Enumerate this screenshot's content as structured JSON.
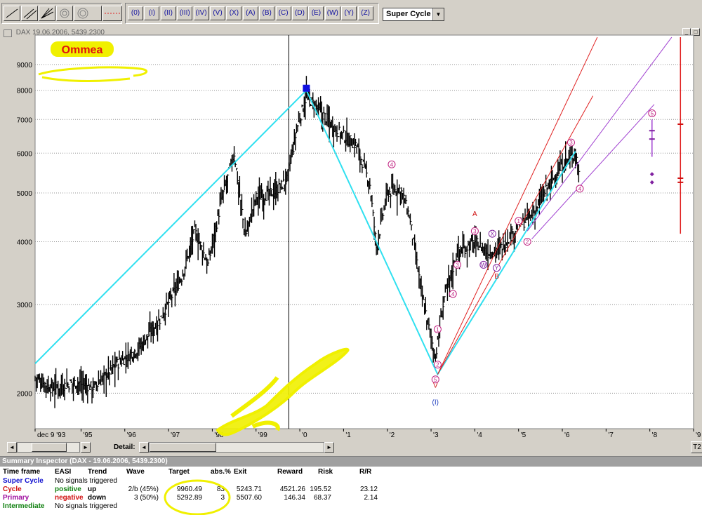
{
  "toolbar": {
    "wave_buttons": [
      "(0)",
      "(I)",
      "(II)",
      "(III)",
      "(IV)",
      "(V)",
      "(X)",
      "(A)",
      "(B)",
      "(C)",
      "(D)",
      "(E)",
      "(W)",
      "(Y)",
      "(Z)"
    ],
    "timeframe_select": "Super Cycle"
  },
  "chart_window": {
    "title": "DAX  19.06.2006, 5439.2300",
    "annotation": "Ommea"
  },
  "chart_data": {
    "type": "bar",
    "scale": "log",
    "ylim": [
      1700,
      10300
    ],
    "yticks": [
      2000,
      3000,
      4000,
      5000,
      6000,
      7000,
      8000,
      9000
    ],
    "ytick_labels": [
      "2000",
      "3000",
      "4000",
      "5000",
      "6000",
      "7000",
      "8000",
      "9000"
    ],
    "x_labels": [
      "dec 9 '93",
      "'95",
      "'96",
      "'97",
      "'98",
      "'99",
      "'0",
      "'1",
      "'2",
      "'3",
      "'4",
      "'5",
      "'6",
      "'7",
      "'8",
      "'9"
    ],
    "xlim": [
      1993.95,
      2009.0
    ],
    "x_ticks": [
      1993.95,
      1995,
      1996,
      1997,
      1998,
      1999,
      2000,
      2001,
      2002,
      2003,
      2004,
      2005,
      2006,
      2007,
      2008,
      2009
    ],
    "vertical_line_x": 1999.75,
    "series_anchor_points": [
      [
        1993.95,
        2150
      ],
      [
        1994.3,
        2050
      ],
      [
        1994.9,
        2100
      ],
      [
        1995.3,
        2050
      ],
      [
        1995.8,
        2280
      ],
      [
        1996.3,
        2450
      ],
      [
        1996.8,
        2800
      ],
      [
        1997.3,
        3400
      ],
      [
        1997.6,
        4200
      ],
      [
        1997.9,
        3600
      ],
      [
        1998.2,
        4800
      ],
      [
        1998.5,
        6000
      ],
      [
        1998.75,
        4100
      ],
      [
        1999.0,
        4900
      ],
      [
        1999.4,
        5000
      ],
      [
        1999.7,
        5300
      ],
      [
        1999.95,
        6800
      ],
      [
        2000.15,
        7800
      ],
      [
        2000.5,
        7200
      ],
      [
        2000.9,
        6600
      ],
      [
        2001.3,
        6200
      ],
      [
        2001.6,
        5200
      ],
      [
        2001.75,
        3900
      ],
      [
        2002.0,
        5000
      ],
      [
        2002.3,
        5100
      ],
      [
        2002.5,
        4500
      ],
      [
        2002.8,
        3100
      ],
      [
        2003.1,
        2350
      ],
      [
        2003.3,
        3100
      ],
      [
        2003.6,
        3800
      ],
      [
        2004.0,
        4000
      ],
      [
        2004.3,
        3800
      ],
      [
        2004.6,
        3900
      ],
      [
        2005.0,
        4300
      ],
      [
        2005.3,
        4500
      ],
      [
        2005.7,
        5200
      ],
      [
        2006.1,
        5800
      ],
      [
        2006.3,
        6000
      ],
      [
        2006.4,
        5440
      ]
    ],
    "cyan_line": [
      [
        1993.95,
        2290
      ],
      [
        2000.15,
        8000
      ],
      [
        2003.15,
        2180
      ],
      [
        2006.3,
        6050
      ]
    ],
    "red_lines": [
      [
        [
          2003.15,
          2180
        ],
        [
          2006.8,
          10200
        ]
      ],
      [
        [
          2003.15,
          2180
        ],
        [
          2006.7,
          7800
        ]
      ]
    ],
    "purple_lines": [
      [
        [
          2005.2,
          4200
        ],
        [
          2008.5,
          10200
        ]
      ],
      [
        [
          2005.3,
          4050
        ],
        [
          2008.1,
          7500
        ]
      ]
    ],
    "red_vertical_x": 2008.7,
    "red_vertical_range": [
      4150,
      10200
    ],
    "top_marker": {
      "x": 2000.15,
      "y": 8050
    },
    "labels": [
      {
        "x": 2001.7,
        "y": 7650,
        "text": "",
        "color": ""
      },
      {
        "x": 2002.1,
        "y": 5700,
        "text": "4",
        "circle": true,
        "color": "#c02080"
      },
      {
        "x": 2003.1,
        "y": 2130,
        "text": "5",
        "circle": true,
        "color": "#c02080"
      },
      {
        "x": 2003.15,
        "y": 2280,
        "text": "2",
        "circle": true,
        "color": "#c02080"
      },
      {
        "x": 2003.15,
        "y": 2680,
        "text": "1",
        "circle": true,
        "color": "#c02080"
      },
      {
        "x": 2003.5,
        "y": 3150,
        "text": "4",
        "circle": true,
        "color": "#c02080"
      },
      {
        "x": 2003.6,
        "y": 3600,
        "text": "3",
        "circle": true,
        "color": "#c02080"
      },
      {
        "x": 2004.0,
        "y": 4200,
        "text": "3",
        "circle": true,
        "color": "#c02080"
      },
      {
        "x": 2004.2,
        "y": 3600,
        "text": "W",
        "circle": true,
        "color": "#8020a0"
      },
      {
        "x": 2004.4,
        "y": 4150,
        "text": "X",
        "circle": true,
        "color": "#8020a0"
      },
      {
        "x": 2004.5,
        "y": 3550,
        "text": "Y",
        "circle": true,
        "color": "#8020a0"
      },
      {
        "x": 2005.0,
        "y": 4400,
        "text": "1",
        "circle": true,
        "color": "#c02080"
      },
      {
        "x": 2005.2,
        "y": 4000,
        "text": "2",
        "circle": true,
        "color": "#c02080"
      },
      {
        "x": 2006.2,
        "y": 6300,
        "text": "3",
        "circle": true,
        "color": "#c02080"
      },
      {
        "x": 2006.4,
        "y": 5100,
        "text": "4",
        "circle": true,
        "color": "#c02080"
      },
      {
        "x": 2008.05,
        "y": 7200,
        "text": "5",
        "circle": true,
        "color": "#c02080"
      }
    ],
    "text_labels": [
      {
        "x": 2004.0,
        "y": 4500,
        "text": "A",
        "color": "#d01010"
      },
      {
        "x": 2004.5,
        "y": 3380,
        "text": "B",
        "color": "#d01010"
      },
      {
        "x": 2003.1,
        "y": 2050,
        "text": "V",
        "color": "#d01010"
      },
      {
        "x": 2003.1,
        "y": 1900,
        "text": "(I)",
        "color": "#2040c0"
      }
    ],
    "target_markers": [
      {
        "x": 2008.05,
        "y": 6650,
        "color": "#8020a0",
        "kind": "dash"
      },
      {
        "x": 2008.05,
        "y": 6400,
        "color": "#8020a0",
        "kind": "dash"
      },
      {
        "x": 2008.05,
        "y": 5450,
        "color": "#8020a0",
        "kind": "diamond"
      },
      {
        "x": 2008.05,
        "y": 5250,
        "color": "#8020a0",
        "kind": "diamond"
      },
      {
        "x": 2008.7,
        "y": 6850,
        "color": "#d01010",
        "kind": "dash"
      },
      {
        "x": 2008.7,
        "y": 5350,
        "color": "#d01010",
        "kind": "dash"
      },
      {
        "x": 2008.7,
        "y": 5250,
        "color": "#d01010",
        "kind": "dash"
      }
    ]
  },
  "scroll": {
    "detail_label": "Detail:",
    "right_button": "T2"
  },
  "summary": {
    "title": "Summary Inspector (DAX - 19.06.2006, 5439.2300)",
    "headers": [
      "Time frame",
      "EASI",
      "Trend",
      "Wave",
      "Target",
      "abs.%",
      "Exit",
      "Reward",
      "Risk",
      "R/R"
    ],
    "rows": [
      {
        "timeframe": "Super Cycle",
        "tf_color": "#1010d0",
        "easi": "No signals triggered",
        "easi_color": "#000000",
        "trend": "",
        "wave": "",
        "target": "",
        "abs": "",
        "exit": "",
        "reward": "",
        "risk": "",
        "rr": ""
      },
      {
        "timeframe": "Cycle",
        "tf_color": "#d01010",
        "easi": "positive",
        "easi_color": "#108010",
        "trend": "up",
        "wave": "2/b (45%)",
        "target": "9960.49",
        "abs": "83",
        "exit": "5243.71",
        "reward": "4521.26",
        "risk": "195.52",
        "rr": "23.12"
      },
      {
        "timeframe": "Primary",
        "tf_color": "#a010a0",
        "easi": "negative",
        "easi_color": "#d01010",
        "trend": "down",
        "wave": "3 (50%)",
        "target": "5292.89",
        "abs": "3",
        "exit": "5507.60",
        "reward": "146.34",
        "risk": "68.37",
        "rr": "2.14"
      },
      {
        "timeframe": "Intermediate",
        "tf_color": "#108010",
        "easi": "No signals triggered",
        "easi_color": "#000000",
        "trend": "",
        "wave": "",
        "target": "",
        "abs": "",
        "exit": "",
        "reward": "",
        "risk": "",
        "rr": ""
      }
    ]
  },
  "colors": {
    "cyan": "#30e0f0",
    "red": "#e02020",
    "purple": "#a040d0",
    "highlight": "#f0f000",
    "marker_blue": "#1010e0"
  }
}
